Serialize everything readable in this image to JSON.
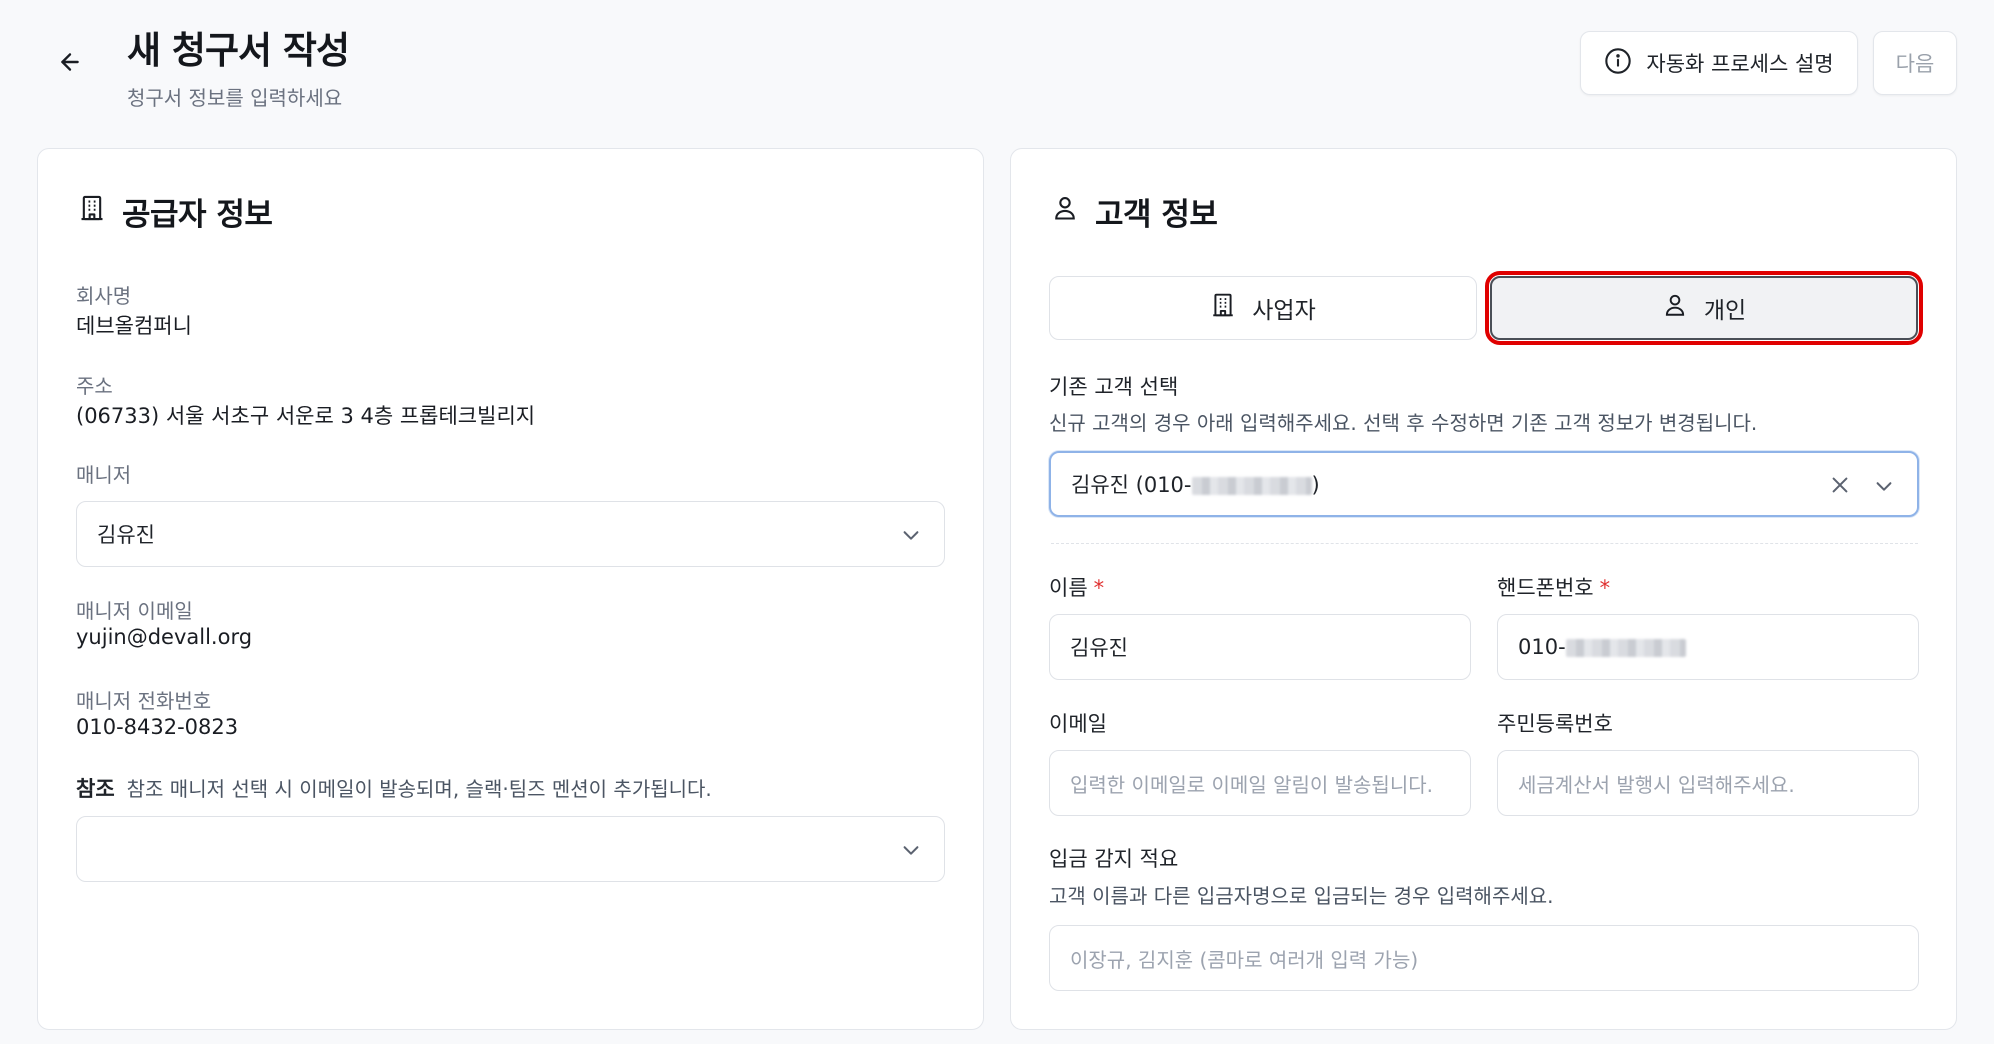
{
  "header": {
    "title": "새 청구서 작성",
    "subtitle": "청구서 정보를 입력하세요",
    "help_button": "자동화 프로세스 설명",
    "next_button": "다음"
  },
  "supplier": {
    "title": "공급자 정보",
    "company_label": "회사명",
    "company_value": "데브올컴퍼니",
    "address_label": "주소",
    "address_value": "(06733) 서울 서초구 서운로 3 4층 프롭테크빌리지",
    "manager_label": "매니저",
    "manager_value": "김유진",
    "manager_email_label": "매니저 이메일",
    "manager_email_value": "yujin@devall.org",
    "manager_phone_label": "매니저 전화번호",
    "manager_phone_value": "010-8432-0823",
    "reference_label": "참조",
    "reference_desc": "참조 매니저 선택 시 이메일이 발송되며, 슬랙·팀즈 멘션이 추가됩니다.",
    "reference_value": ""
  },
  "customer": {
    "title": "고객 정보",
    "type_business": "사업자",
    "type_individual": "개인",
    "existing_label": "기존 고객 선택",
    "existing_desc": "신규 고객의 경우 아래 입력해주세요. 선택 후 수정하면 기존 고객 정보가 변경됩니다.",
    "existing_value_prefix": "김유진 (010-",
    "existing_value_suffix": ")",
    "name_label": "이름",
    "name_value": "김유진",
    "phone_label": "핸드폰번호",
    "phone_value_prefix": "010-",
    "required_mark": "*",
    "email_label": "이메일",
    "email_placeholder": "입력한 이메일로 이메일 알림이 발송됩니다.",
    "rrn_label": "주민등록번호",
    "rrn_placeholder": "세금계산서 발행시 입력해주세요.",
    "deposit_label": "입금 감지 적요",
    "deposit_desc": "고객 이름과 다른 입금자명으로 입금되는 경우 입력해주세요.",
    "deposit_placeholder": "이장규, 김지훈 (콤마로 여러개 입력 가능)"
  },
  "icons": {
    "back": "arrow-left-icon",
    "info": "info-circle-icon",
    "building": "building-icon",
    "user": "user-icon",
    "chevron": "chevron-down-icon",
    "clear": "close-icon"
  },
  "colors": {
    "required": "#e03131",
    "focus_border": "#8fb3e8",
    "highlight": "#e00000"
  }
}
